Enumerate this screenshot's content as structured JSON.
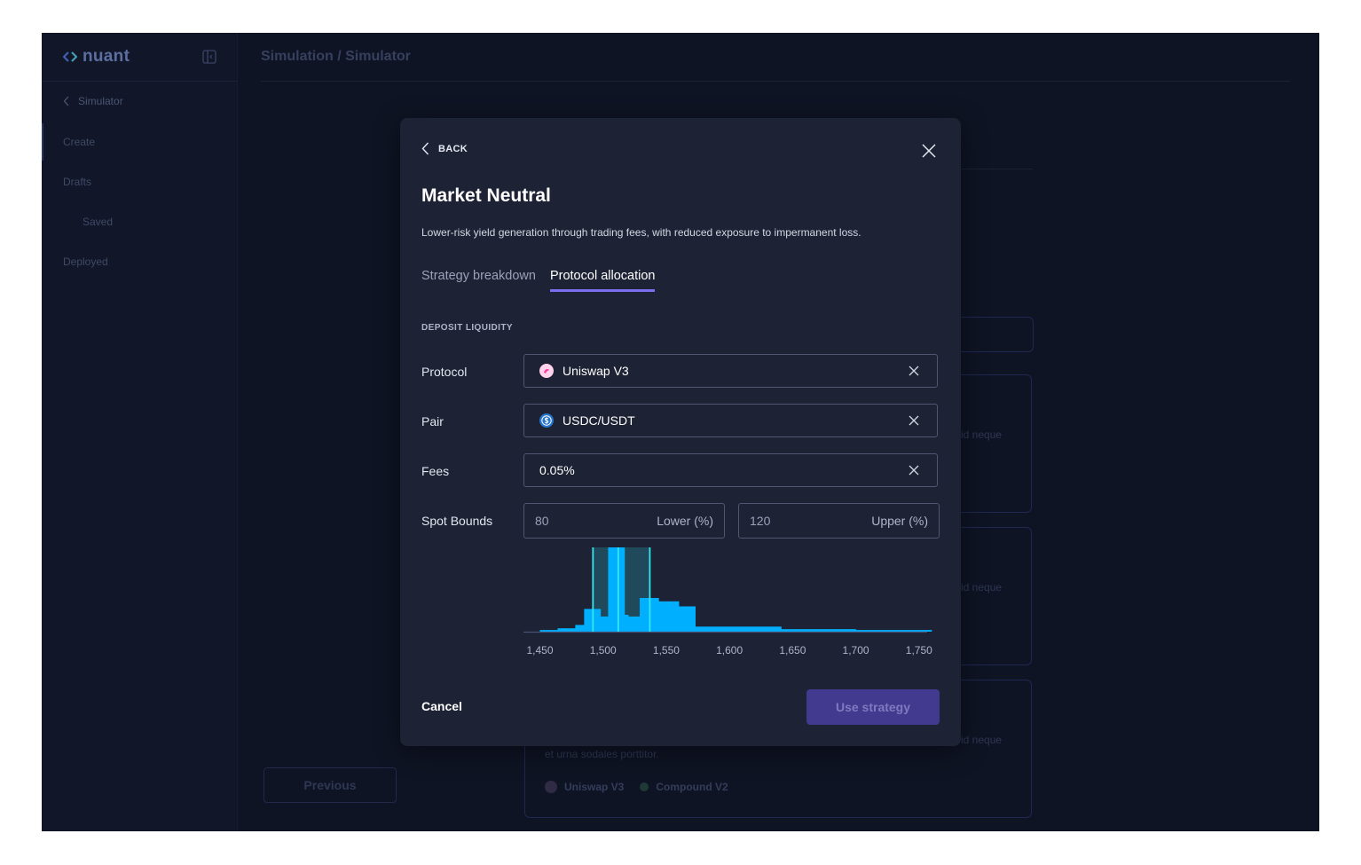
{
  "app": {
    "logo_text": "nuant",
    "sidebar": {
      "back_label": "Simulator",
      "items": [
        {
          "label": "Create"
        },
        {
          "label": "Drafts"
        },
        {
          "label": "Saved"
        },
        {
          "label": "Deployed"
        }
      ]
    },
    "page_title": "Simulation / Simulator",
    "background": {
      "card_fragment": "id neque",
      "card_text": "et urna sodales porttitor.",
      "card_tags": [
        "Uniswap V3",
        "Compound V2"
      ],
      "previous_label": "Previous"
    }
  },
  "modal": {
    "back_label": "BACK",
    "title": "Market Neutral",
    "description": "Lower-risk yield generation through trading fees, with reduced exposure to impermanent loss.",
    "tabs": [
      {
        "label": "Strategy breakdown",
        "active": false
      },
      {
        "label": "Protocol allocation",
        "active": true
      }
    ],
    "section_label": "DEPOSIT LIQUIDITY",
    "fields": {
      "protocol": {
        "label": "Protocol",
        "value": "Uniswap V3",
        "icon": "uniswap-icon"
      },
      "pair": {
        "label": "Pair",
        "value": "USDC/USDT",
        "icon": "usdc-icon"
      },
      "fees": {
        "label": "Fees",
        "value": "0.05%"
      }
    },
    "spot_bounds": {
      "label": "Spot Bounds",
      "lower": {
        "value": "80",
        "unit": "Lower (%)"
      },
      "upper": {
        "value": "120",
        "unit": "Upper (%)"
      }
    },
    "cancel_label": "Cancel",
    "use_label": "Use strategy"
  },
  "colors": {
    "accent": "#7b6ff0",
    "histogram": "#00b0ff",
    "range_fill": "#20495c",
    "range_line": "#35e6ee"
  },
  "chart_data": {
    "type": "bar",
    "x_ticks": [
      1450,
      1500,
      1550,
      1600,
      1650,
      1700,
      1750
    ],
    "xlim": [
      1437,
      1767
    ],
    "ylim": [
      0,
      100
    ],
    "bins": [
      {
        "x0": 1450,
        "x1": 1464,
        "v": 2
      },
      {
        "x0": 1464,
        "x1": 1478,
        "v": 4
      },
      {
        "x0": 1478,
        "x1": 1485,
        "v": 8
      },
      {
        "x0": 1485,
        "x1": 1498,
        "v": 27
      },
      {
        "x0": 1498,
        "x1": 1504,
        "v": 18
      },
      {
        "x0": 1504,
        "x1": 1517,
        "v": 100
      },
      {
        "x0": 1517,
        "x1": 1520,
        "v": 20
      },
      {
        "x0": 1520,
        "x1": 1529,
        "v": 18
      },
      {
        "x0": 1529,
        "x1": 1544,
        "v": 40
      },
      {
        "x0": 1544,
        "x1": 1560,
        "v": 36
      },
      {
        "x0": 1560,
        "x1": 1573,
        "v": 30
      },
      {
        "x0": 1573,
        "x1": 1641,
        "v": 6
      },
      {
        "x0": 1641,
        "x1": 1700,
        "v": 3
      },
      {
        "x0": 1700,
        "x1": 1760,
        "v": 2
      }
    ],
    "range": {
      "lower": 1492,
      "upper": 1537,
      "current": 1512
    }
  }
}
